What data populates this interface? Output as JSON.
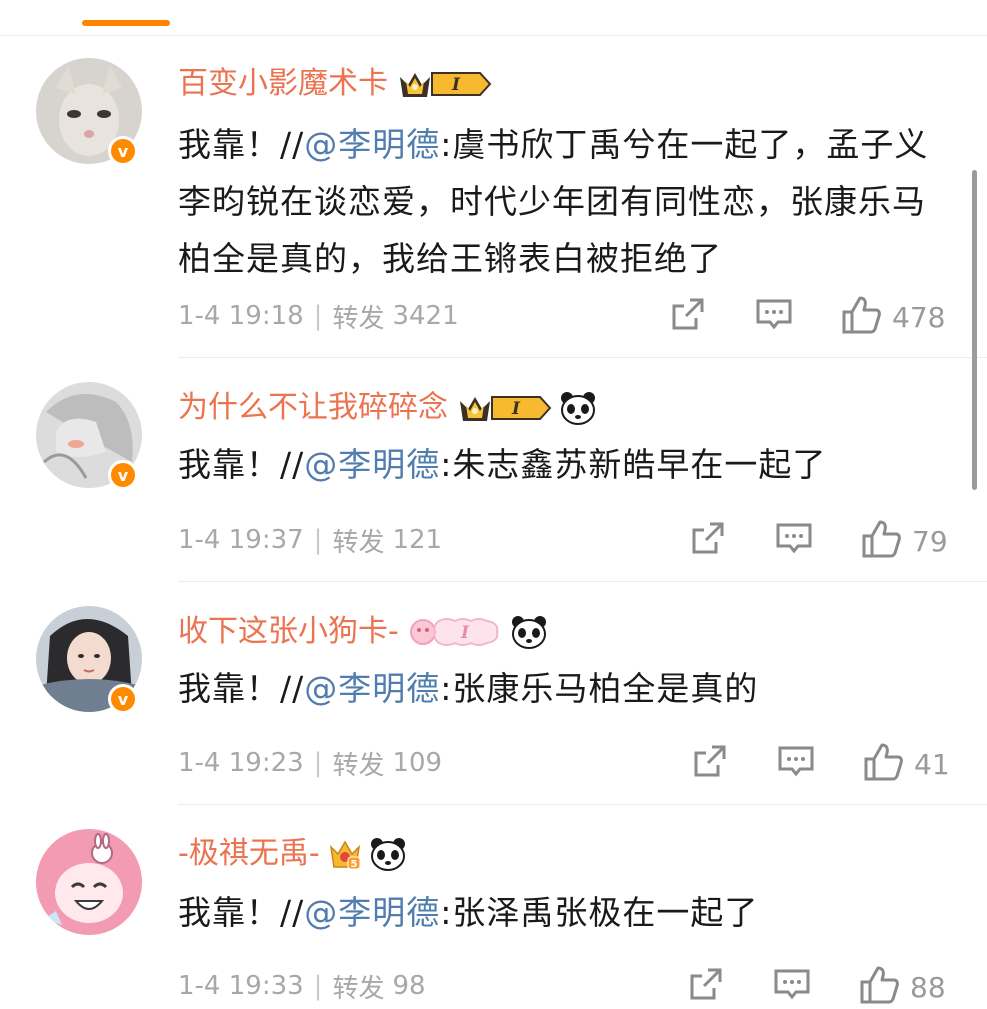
{
  "comments": [
    {
      "username": "百变小影魔术卡",
      "text_prefix": "我靠！//",
      "mention": "@李明德",
      "text_body": ":虞书欣丁禹兮在一起了，孟子义李昀锐在谈恋爱，时代少年团有同性恋，张康乐马柏全是真的，我给王锵表白被拒绝了",
      "time": "1-4 19:18",
      "repost_label": "转发",
      "repost_count": "3421",
      "like_count": "478",
      "badge_level": "I",
      "has_panda": false
    },
    {
      "username": "为什么不让我碎碎念",
      "text_prefix": "我靠！//",
      "mention": "@李明德",
      "text_body": ":朱志鑫苏新皓早在一起了",
      "time": "1-4 19:37",
      "repost_label": "转发",
      "repost_count": "121",
      "like_count": "79",
      "badge_level": "I",
      "has_panda": true
    },
    {
      "username": "收下这张小狗卡-",
      "text_prefix": "我靠！//",
      "mention": "@李明德",
      "text_body": ":张康乐马柏全是真的",
      "time": "1-4 19:23",
      "repost_label": "转发",
      "repost_count": "109",
      "like_count": "41",
      "badge_level": "I",
      "has_panda": true
    },
    {
      "username": "-极祺无禹-",
      "text_prefix": "我靠！//",
      "mention": "@李明德",
      "text_body": ":张泽禹张极在一起了",
      "time": "1-4 19:33",
      "repost_label": "转发",
      "repost_count": "98",
      "like_count": "88",
      "badge_level": "5",
      "has_panda": true
    }
  ],
  "verified_mark": "v",
  "colors": {
    "accent": "#ff8200",
    "username": "#eb7350",
    "mention": "#507daf",
    "meta": "#a8a8a8",
    "verified": "#ff8a00"
  },
  "icons": [
    "share-icon",
    "comment-icon",
    "like-icon",
    "crown-badge-icon",
    "panda-icon",
    "verified-icon"
  ]
}
